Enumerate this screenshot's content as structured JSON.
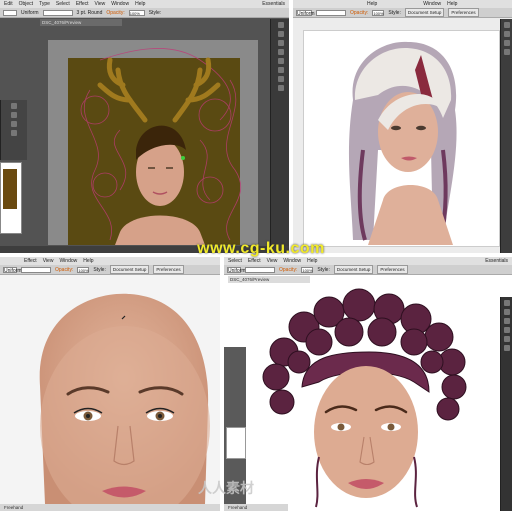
{
  "watermark": "www.cg-ku.com",
  "watermark_logo": "人人素材",
  "quadrants": [
    {
      "menu": [
        "Edit",
        "Object",
        "Type",
        "Select",
        "Effect",
        "View",
        "Window",
        "Help"
      ],
      "brand": "Ai",
      "workspace": "Essentials",
      "doc_tab": "DSC_4076/Preview",
      "ctrl": {
        "mode": "Uniform",
        "stroke": "3 pt. Round",
        "opacity_label": "Opacity:",
        "opacity_val": "100%",
        "style": "Style:"
      }
    },
    {
      "menu": [
        "Help",
        "Window",
        "Help"
      ],
      "ctrl": {
        "stroke": "Uniform",
        "opacity_label": "Opacity:",
        "opacity_val": "100%",
        "style": "Style:",
        "doc_setup": "Document Setup",
        "prefs": "Preferences"
      }
    },
    {
      "menu": [
        "Effect",
        "View",
        "Window",
        "Help"
      ],
      "ctrl": {
        "mode": "Uniform",
        "opacity_label": "Opacity:",
        "opacity_val": "100%",
        "style": "Style:",
        "doc_setup": "Document Setup",
        "prefs": "Preferences"
      },
      "status": "Freehand"
    },
    {
      "menu": [
        "Select",
        "Effect",
        "View",
        "Window",
        "Help"
      ],
      "workspace": "Essentials",
      "doc_tab": "DSC_4076/Preview",
      "ctrl": {
        "mode": "Uniform",
        "opacity_label": "Opacity:",
        "opacity_val": "100%",
        "style": "Style:",
        "doc_setup": "Document Setup",
        "prefs": "Preferences"
      },
      "status": "Freehand"
    }
  ],
  "colors": {
    "canvas_brown": "#5a4a12",
    "antler": "#a07a1e",
    "hair_purple": "#5b2340",
    "skin": "#d9a48a",
    "watermark": "#f1ea2a"
  }
}
